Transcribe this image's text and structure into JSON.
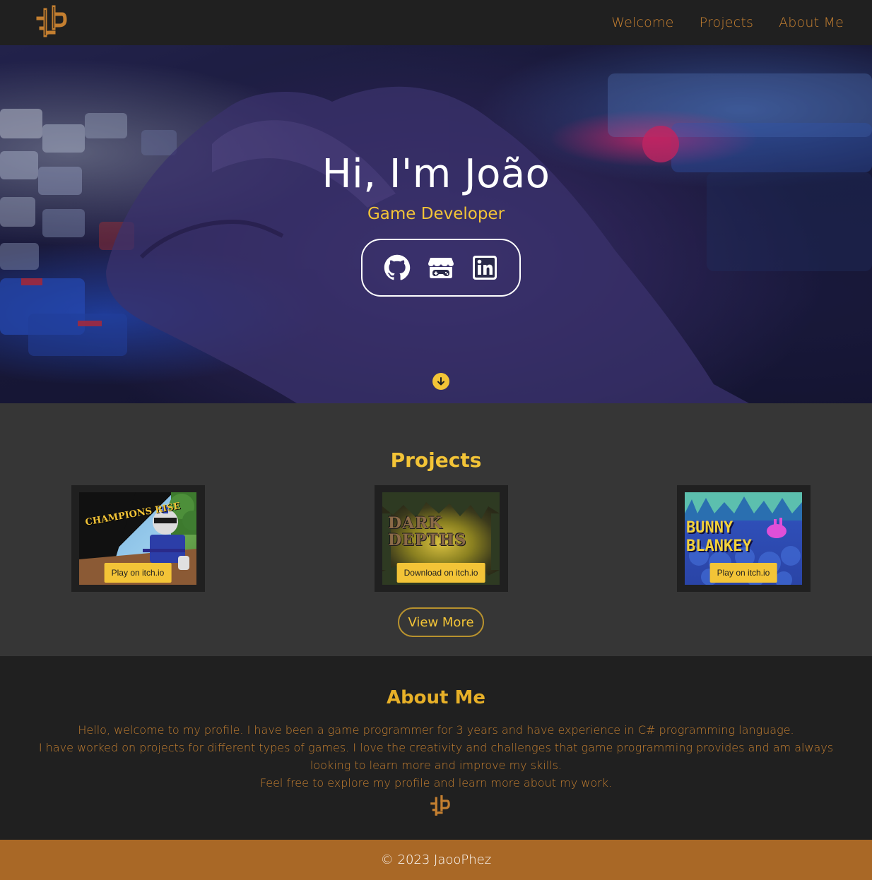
{
  "nav": {
    "logo_icon": "jp-logo-icon",
    "links": [
      "Welcome",
      "Projects",
      "About Me"
    ]
  },
  "hero": {
    "title": "Hi, I'm João",
    "subtitle": "Game Developer",
    "social": [
      "github-icon",
      "itchio-icon",
      "linkedin-icon"
    ],
    "scroll_icon": "arrow-down-circle-icon"
  },
  "projects": {
    "title": "Projects",
    "items": [
      {
        "thumb_text": "CHAMPIONS RISE",
        "button": "Play on itch.io"
      },
      {
        "thumb_text": "DARK DEPTHS",
        "button": "Download on itch.io"
      },
      {
        "thumb_text": "BUNNY BLANKEY",
        "button": "Play on itch.io"
      }
    ],
    "view_more": "View More"
  },
  "about": {
    "title": "About Me",
    "lines": [
      "Hello, welcome to my profile. I have been a game programmer for 3 years and have experience in C# programming language.",
      "I have worked on projects for different types of games. I love the creativity and challenges that game programming provides and am always looking to learn more and improve my skills.",
      "Feel free to explore my profile and learn more about my work."
    ]
  },
  "footer": {
    "text": "© 2023 JaooPhez"
  },
  "colors": {
    "accent": "#f3c437",
    "nav_link": "#c47f30",
    "footer_bg": "#a96826",
    "bg_dark": "#202020",
    "bg_mid": "#363636"
  }
}
